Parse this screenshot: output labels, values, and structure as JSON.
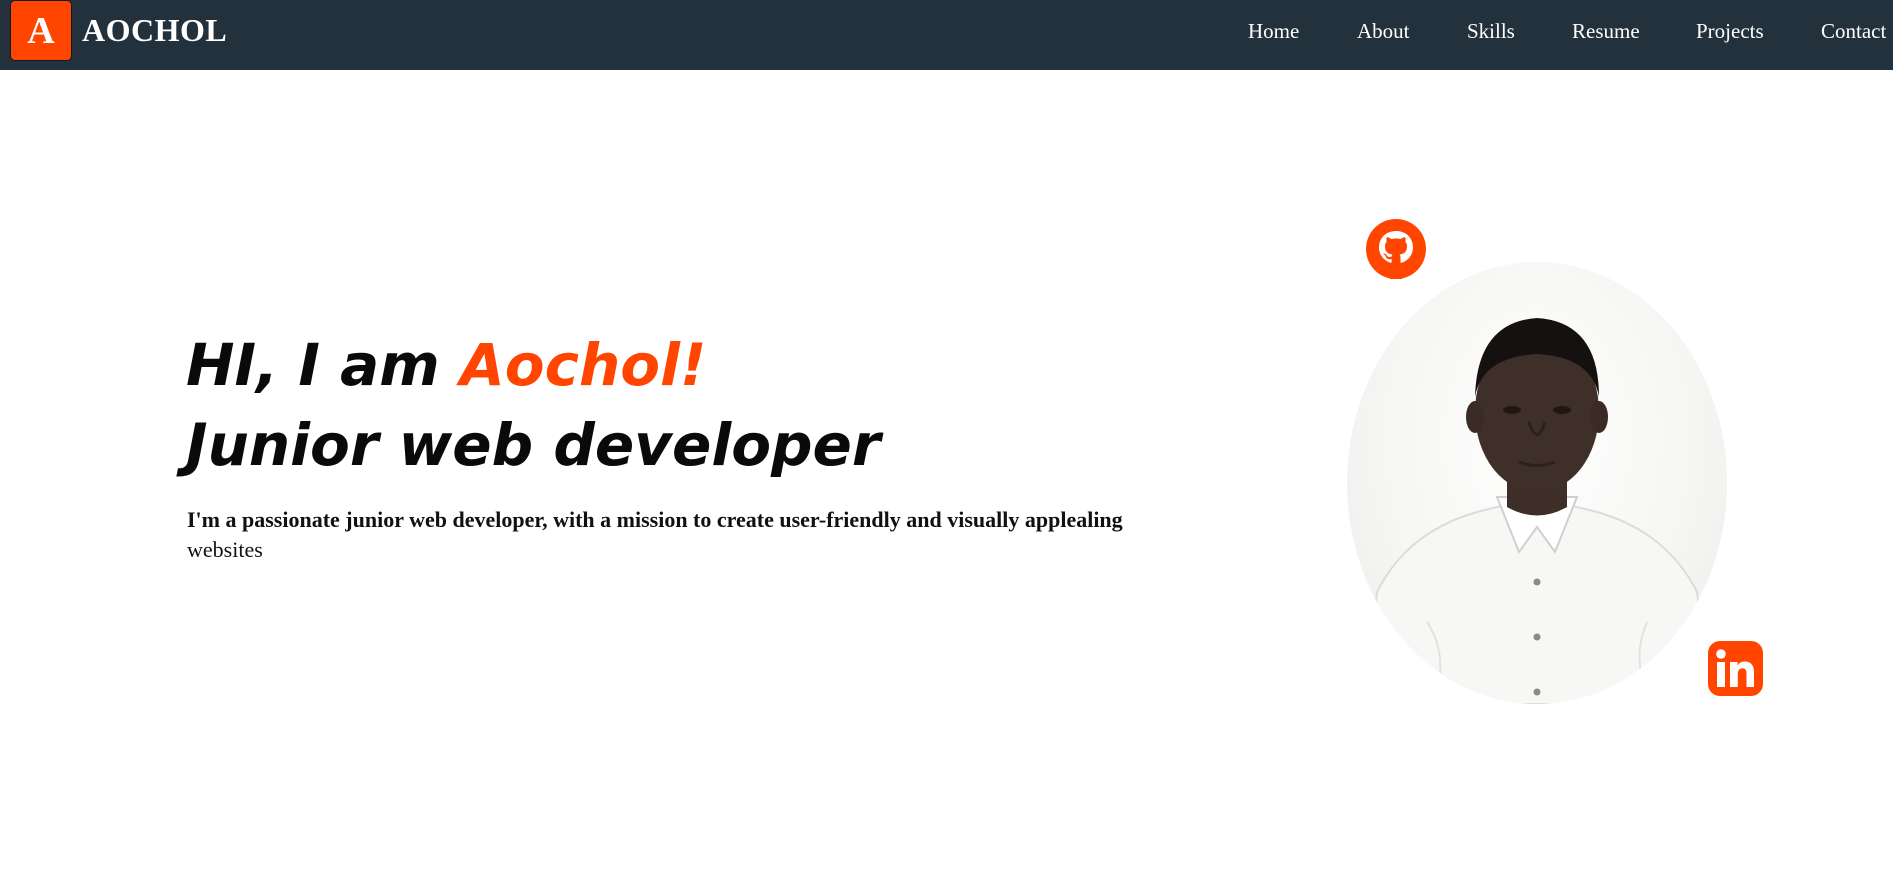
{
  "brand": {
    "logo_letter": "A",
    "name": "AOCHOL"
  },
  "nav": {
    "items": [
      {
        "label": "Home"
      },
      {
        "label": "About"
      },
      {
        "label": "Skills"
      },
      {
        "label": "Resume"
      },
      {
        "label": "Projects"
      },
      {
        "label": "Contact"
      }
    ]
  },
  "hero": {
    "greeting": "HI, I am ",
    "name": "Aochol!",
    "role": "Junior web developer",
    "description_bold": "I'm a passionate junior web developer, with a mission to create user-friendly and visually applealing",
    "description_tail": "websites"
  },
  "social": {
    "github_icon": "github-icon",
    "linkedin_icon": "linkedin-icon"
  },
  "colors": {
    "navbar_bg": "#22313c",
    "accent": "#ff4500",
    "text": "#0a0a0a",
    "background": "#ffffff"
  }
}
